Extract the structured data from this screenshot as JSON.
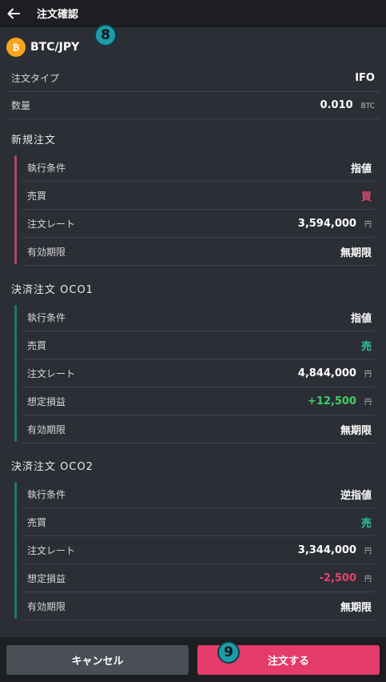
{
  "header": {
    "title": "注文確認"
  },
  "pair": {
    "name": "BTC/JPY",
    "icon": "bitcoin-icon"
  },
  "badges": {
    "b8": "8",
    "b9": "9"
  },
  "summary": [
    {
      "label": "注文タイプ",
      "value": "IFO",
      "unit": ""
    },
    {
      "label": "数量",
      "value": "0.010",
      "unit": "BTC"
    }
  ],
  "sections": [
    {
      "title": "新規注文",
      "color": "#b0476a",
      "rows": [
        {
          "label": "執行条件",
          "value": "指値",
          "unit": "",
          "tone": ""
        },
        {
          "label": "売買",
          "value": "買",
          "unit": "",
          "tone": "buy"
        },
        {
          "label": "注文レート",
          "value": "3,594,000",
          "unit": "円",
          "tone": ""
        },
        {
          "label": "有効期限",
          "value": "無期限",
          "unit": "",
          "tone": ""
        }
      ]
    },
    {
      "title": "決済注文 OCO1",
      "color": "#1f7a68",
      "rows": [
        {
          "label": "執行条件",
          "value": "指値",
          "unit": "",
          "tone": ""
        },
        {
          "label": "売買",
          "value": "売",
          "unit": "",
          "tone": "sell"
        },
        {
          "label": "注文レート",
          "value": "4,844,000",
          "unit": "円",
          "tone": ""
        },
        {
          "label": "想定損益",
          "value": "+12,500",
          "unit": "円",
          "tone": "profit"
        },
        {
          "label": "有効期限",
          "value": "無期限",
          "unit": "",
          "tone": ""
        }
      ]
    },
    {
      "title": "決済注文 OCO2",
      "color": "#1f7a68",
      "rows": [
        {
          "label": "執行条件",
          "value": "逆指値",
          "unit": "",
          "tone": ""
        },
        {
          "label": "売買",
          "value": "売",
          "unit": "",
          "tone": "sell"
        },
        {
          "label": "注文レート",
          "value": "3,344,000",
          "unit": "円",
          "tone": ""
        },
        {
          "label": "想定損益",
          "value": "-2,500",
          "unit": "円",
          "tone": "loss"
        },
        {
          "label": "有効期限",
          "value": "無期限",
          "unit": "",
          "tone": ""
        }
      ]
    }
  ],
  "footer": {
    "cancel_label": "キャンセル",
    "order_label": "注文する"
  }
}
